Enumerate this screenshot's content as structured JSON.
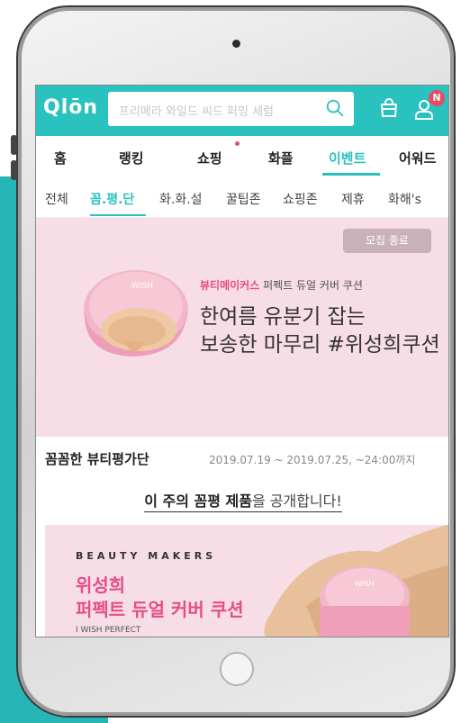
{
  "header": {
    "logo": "Qlōn",
    "search_placeholder": "프리메라 와일드 씨드 퍼밍 세럼",
    "notification_badge": "N"
  },
  "gnb": {
    "items": [
      {
        "label": "홈",
        "active": false
      },
      {
        "label": "랭킹",
        "active": false
      },
      {
        "label": "쇼핑",
        "active": false
      },
      {
        "label": "화플",
        "active": false
      },
      {
        "label": "이벤트",
        "active": true
      },
      {
        "label": "어워드",
        "active": false
      }
    ]
  },
  "subnav": {
    "items": [
      {
        "label": "전체",
        "active": false
      },
      {
        "label": "꼼.평.단",
        "active": true
      },
      {
        "label": "화.화.설",
        "active": false
      },
      {
        "label": "꿀팁존",
        "active": false
      },
      {
        "label": "쇼핑존",
        "active": false
      },
      {
        "label": "제휴",
        "active": false
      },
      {
        "label": "화해's",
        "active": false
      }
    ]
  },
  "banner": {
    "status": "모집 종료",
    "subtitle_brand": "뷰티메이커스",
    "subtitle_product": "퍼펙트 듀얼 커버 쿠션",
    "title_line1": "한여름 유분기 잡는",
    "title_line2": "보송한 마무리 #위성희쿠션",
    "product_mark": "WISH"
  },
  "event": {
    "name": "꼼꼼한 뷰티평가단",
    "date": "2019.07.19 ~ 2019.07.25, ~24:00까지"
  },
  "reveal": {
    "bold": "이 주의 꼼평 제품",
    "rest": "을 공개합니다!"
  },
  "card": {
    "brand": "BEAUTY MAKERS",
    "title_line1": "위성희",
    "title_line2": "퍼펙트 듀얼 커버 쿠션",
    "small": "I WISH PERFECT",
    "product_mark": "WISH"
  },
  "colors": {
    "accent": "#2ac2bf",
    "pink": "#e84c88",
    "banner_bg": "#f6dde6",
    "side_block": "#27b6b8"
  }
}
